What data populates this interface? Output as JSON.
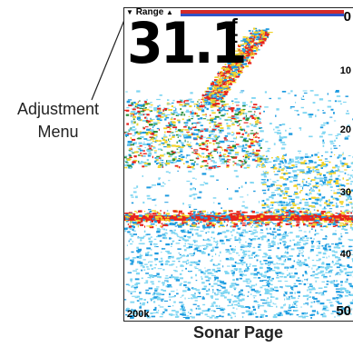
{
  "callout": {
    "line1": "Adjustment",
    "line2": "Menu"
  },
  "screen": {
    "range_label": "Range",
    "depth_value": "31.1",
    "depth_unit_top": "f",
    "depth_unit_bottom": "t",
    "scale": [
      "0",
      "10",
      "20",
      "30",
      "40",
      "50"
    ],
    "frequency": "200k"
  },
  "caption": "Sonar Page",
  "colors": {
    "red_bar": "#d32b2b",
    "blue_bar": "#2f52c8",
    "strong_return": "#e8231c",
    "medium_return": "#f2d32a",
    "weak_return": "#1e9be0",
    "faint_return": "#7fd6f2"
  }
}
